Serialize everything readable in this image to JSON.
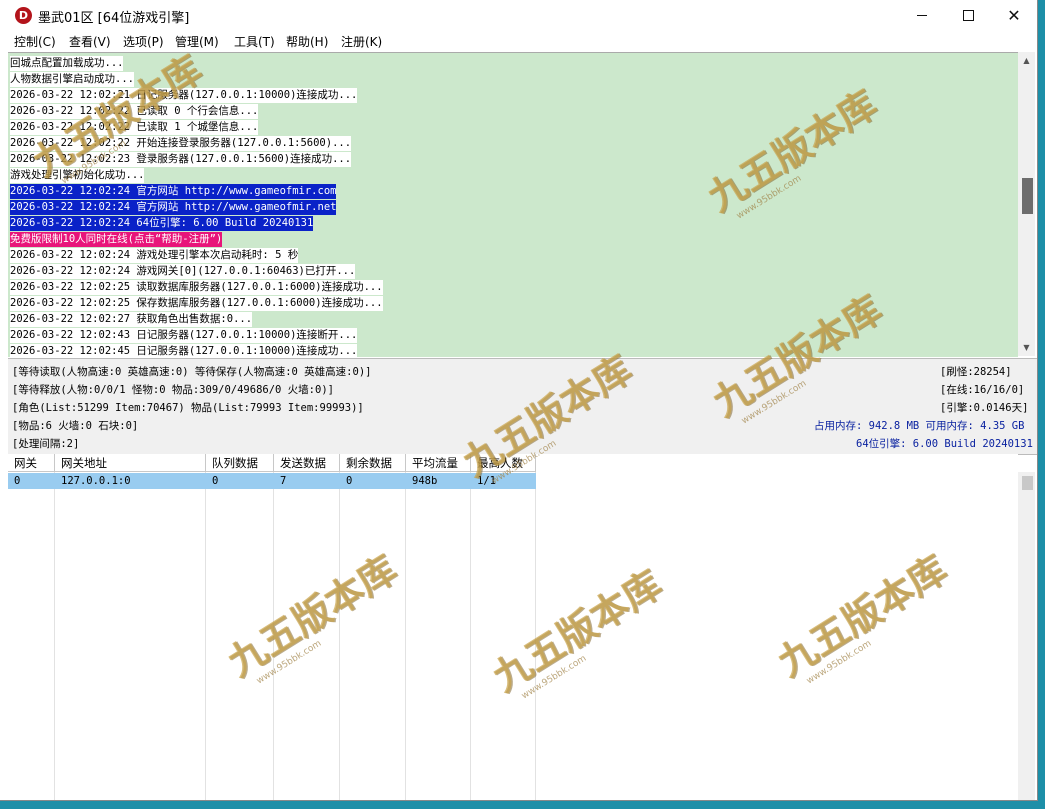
{
  "window": {
    "app_icon": "D",
    "title": "墨武01区 [64位游戏引擎]",
    "minimize_icon": "minimize-icon",
    "maximize_icon": "maximize-icon",
    "close_icon": "close-icon"
  },
  "menu": [
    "控制(C)",
    "查看(V)",
    "选项(P)",
    "管理(M)",
    "工具(T)",
    "帮助(H)",
    "注册(K)"
  ],
  "log": [
    {
      "text": "回城点配置加载成功...",
      "style": "white"
    },
    {
      "text": "人物数据引擎启动成功...",
      "style": "white"
    },
    {
      "text": "2026-03-22 12:02:21 日记服务器(127.0.0.1:10000)连接成功...",
      "style": "white"
    },
    {
      "text": "2026-03-22 12:02:22 已读取 0 个行会信息...",
      "style": "white"
    },
    {
      "text": "2026-03-22 12:02:22 已读取 1 个城堡信息...",
      "style": "white"
    },
    {
      "text": "2026-03-22 12:02:22 开始连接登录服务器(127.0.0.1:5600)...",
      "style": "white"
    },
    {
      "text": "2026-03-22 12:02:23 登录服务器(127.0.0.1:5600)连接成功...",
      "style": "white"
    },
    {
      "text": "游戏处理引擎初始化成功...",
      "style": "white"
    },
    {
      "text": "2026-03-22 12:02:24 官方网站 http://www.gameofmir.com",
      "style": "selected"
    },
    {
      "text": "2026-03-22 12:02:24 官方网站 http://www.gameofmir.net",
      "style": "selected"
    },
    {
      "text": "2026-03-22 12:02:24 64位引擎: 6.00 Build 20240131",
      "style": "selected"
    },
    {
      "text": "免费版限制10人同时在线(点击“帮助-注册”)",
      "style": "warning"
    },
    {
      "text": "2026-03-22 12:02:24 游戏处理引擎本次启动耗时: 5 秒",
      "style": "white"
    },
    {
      "text": "2026-03-22 12:02:24 游戏网关[0](127.0.0.1:60463)已打开...",
      "style": "white"
    },
    {
      "text": "2026-03-22 12:02:25 读取数据库服务器(127.0.0.1:6000)连接成功...",
      "style": "white"
    },
    {
      "text": "2026-03-22 12:02:25 保存数据库服务器(127.0.0.1:6000)连接成功...",
      "style": "white"
    },
    {
      "text": "2026-03-22 12:02:27 获取角色出售数据:0...",
      "style": "white"
    },
    {
      "text": "2026-03-22 12:02:43 日记服务器(127.0.0.1:10000)连接断开...",
      "style": "white"
    },
    {
      "text": "2026-03-22 12:02:45 日记服务器(127.0.0.1:10000)连接成功...",
      "style": "white"
    }
  ],
  "status": {
    "line1": "[等待读取(人物高速:0 英雄高速:0) 等待保存(人物高速:0 英雄高速:0)]",
    "line2": "[等待释放(人物:0/0/1 怪物:0 物品:309/0/49686/0 火墙:0)]",
    "line3": "[角色(List:51299 Item:70467) 物品(List:79993 Item:99993)]",
    "line4": "[物品:6 火墙:0 石块:0]",
    "line5": "[处理间隔:2]",
    "refresh_monsters": "[刷怪:28254]",
    "online": "[在线:16/16/0]",
    "engine_days": "[引擎:0.0146天]",
    "memory": "占用内存: 942.8 MB 可用内存: 4.35 GB",
    "engine_version": "64位引擎: 6.00 Build 20240131"
  },
  "gateway_table": {
    "columns": [
      "网关",
      "网关地址",
      "队列数据",
      "发送数据",
      "剩余数据",
      "平均流量",
      "最高人数"
    ],
    "rows": [
      [
        "0",
        "127.0.0.1:0",
        "0",
        "7",
        "0",
        "948b",
        "1/1"
      ]
    ]
  },
  "watermark": {
    "text": "九五版本库",
    "url": "www.95bbk.com"
  },
  "colors": {
    "log_background": "#cce8cc",
    "selection": "#0a22c8",
    "warning": "#e8157a",
    "table_selection": "#99ccf0",
    "desktop": "#1d8fa8"
  }
}
